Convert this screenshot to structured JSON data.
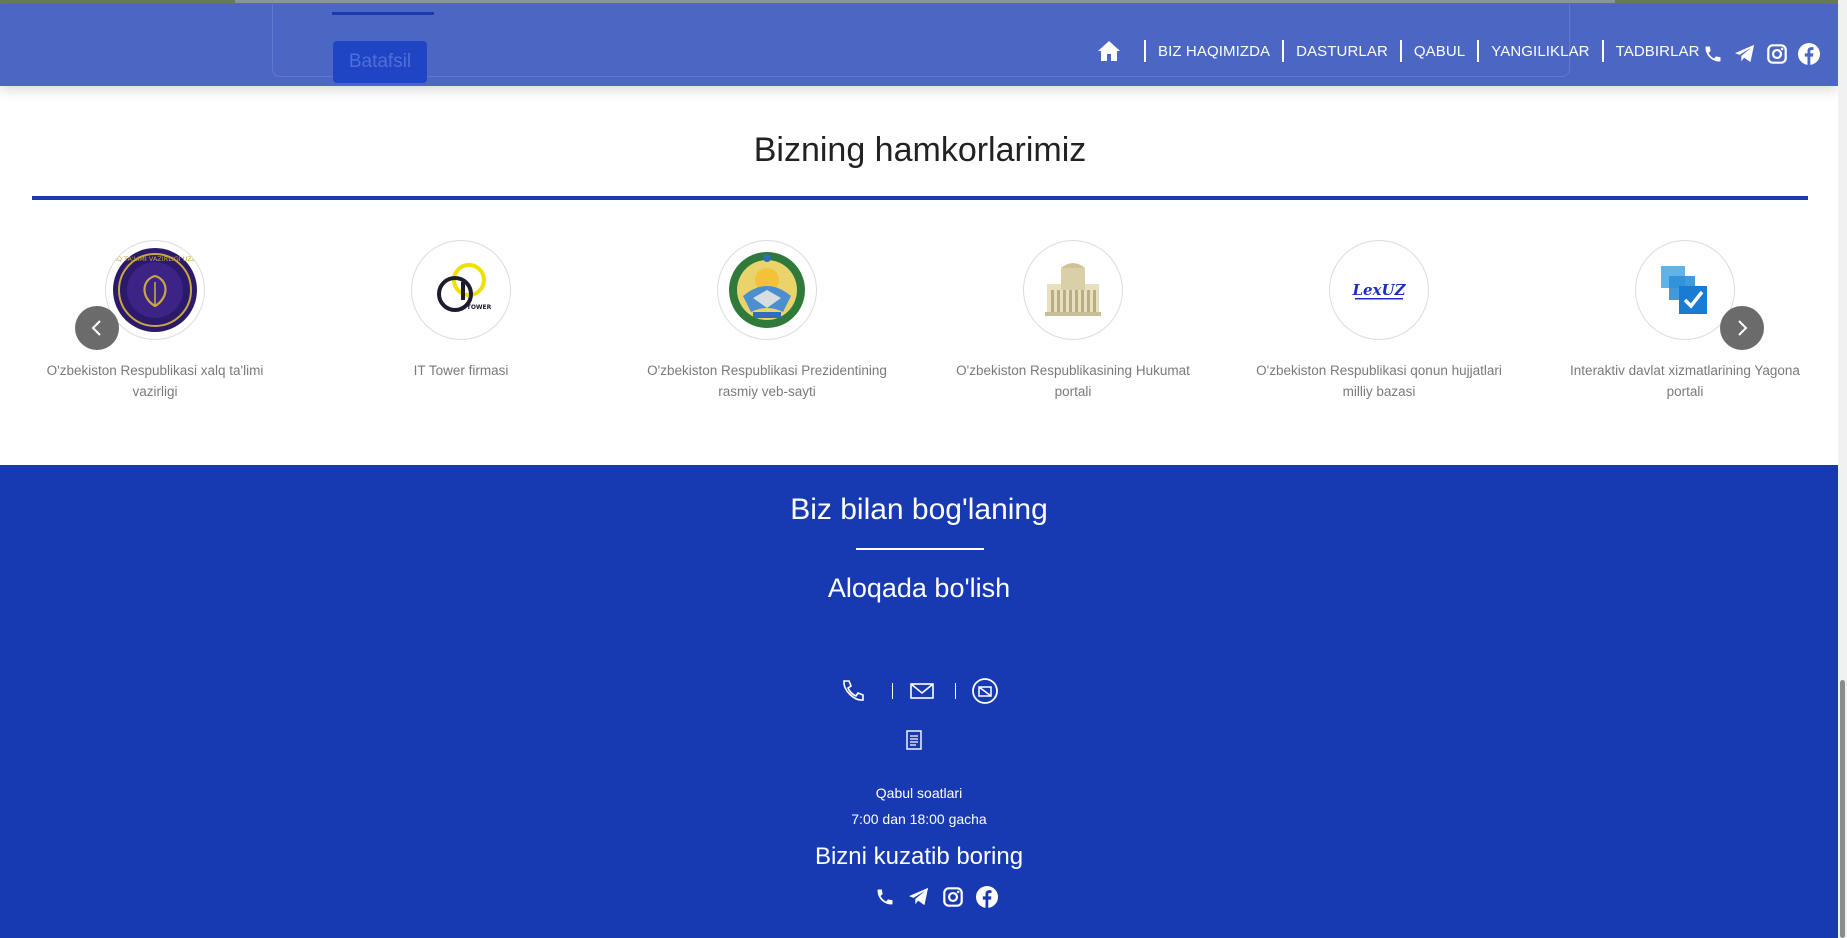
{
  "header": {
    "cta_label": "Batafsil",
    "nav": [
      "BIZ HAQIMIZDA",
      "DASTURLAR",
      "QABUL",
      "YANGILIKLAR",
      "TADBIRLAR"
    ],
    "social_icons": [
      "phone-icon",
      "telegram-icon",
      "instagram-icon",
      "facebook-icon"
    ]
  },
  "partners": {
    "title": "Bizning hamkorlarimiz",
    "items": [
      {
        "caption": "O'zbekiston Respublikasi xalq ta'limi vazirligi",
        "logo": "ministry-education-logo",
        "logo_text": "XALQ TA'LIMI VAZIRLIGI UZEDU"
      },
      {
        "caption": "IT Tower firmasi",
        "logo": "it-tower-logo",
        "logo_text": "TOWER"
      },
      {
        "caption": "O'zbekiston Respublikasi Prezidentining rasmiy veb-sayti",
        "logo": "state-emblem-logo"
      },
      {
        "caption": "O'zbekiston Respublikasining Hukumat portali",
        "logo": "government-building-logo"
      },
      {
        "caption": "O'zbekiston Respublikasi qonun hujjatlari milliy bazasi",
        "logo": "lexuz-logo",
        "logo_text": "LexUZ"
      },
      {
        "caption": "Interaktiv davlat xizmatlarining Yagona portali",
        "logo": "my-gov-logo"
      }
    ]
  },
  "footer": {
    "title": "Biz bilan bog'laning",
    "subtitle": "Aloqada bo'lish",
    "contact_icons": [
      "phone-icon",
      "mail-icon",
      "location-icon",
      "document-icon"
    ],
    "hours_label": "Qabul soatlari",
    "hours_value": "7:00 dan 18:00 gacha",
    "follow_title": "Bizni kuzatib boring",
    "social_icons": [
      "phone-icon",
      "telegram-icon",
      "instagram-icon",
      "facebook-icon"
    ]
  },
  "colors": {
    "header_bg": "#4c66c4",
    "accent": "#1b3ab0",
    "footer_bg": "#173ab2",
    "button_bg": "#1f44c4"
  }
}
